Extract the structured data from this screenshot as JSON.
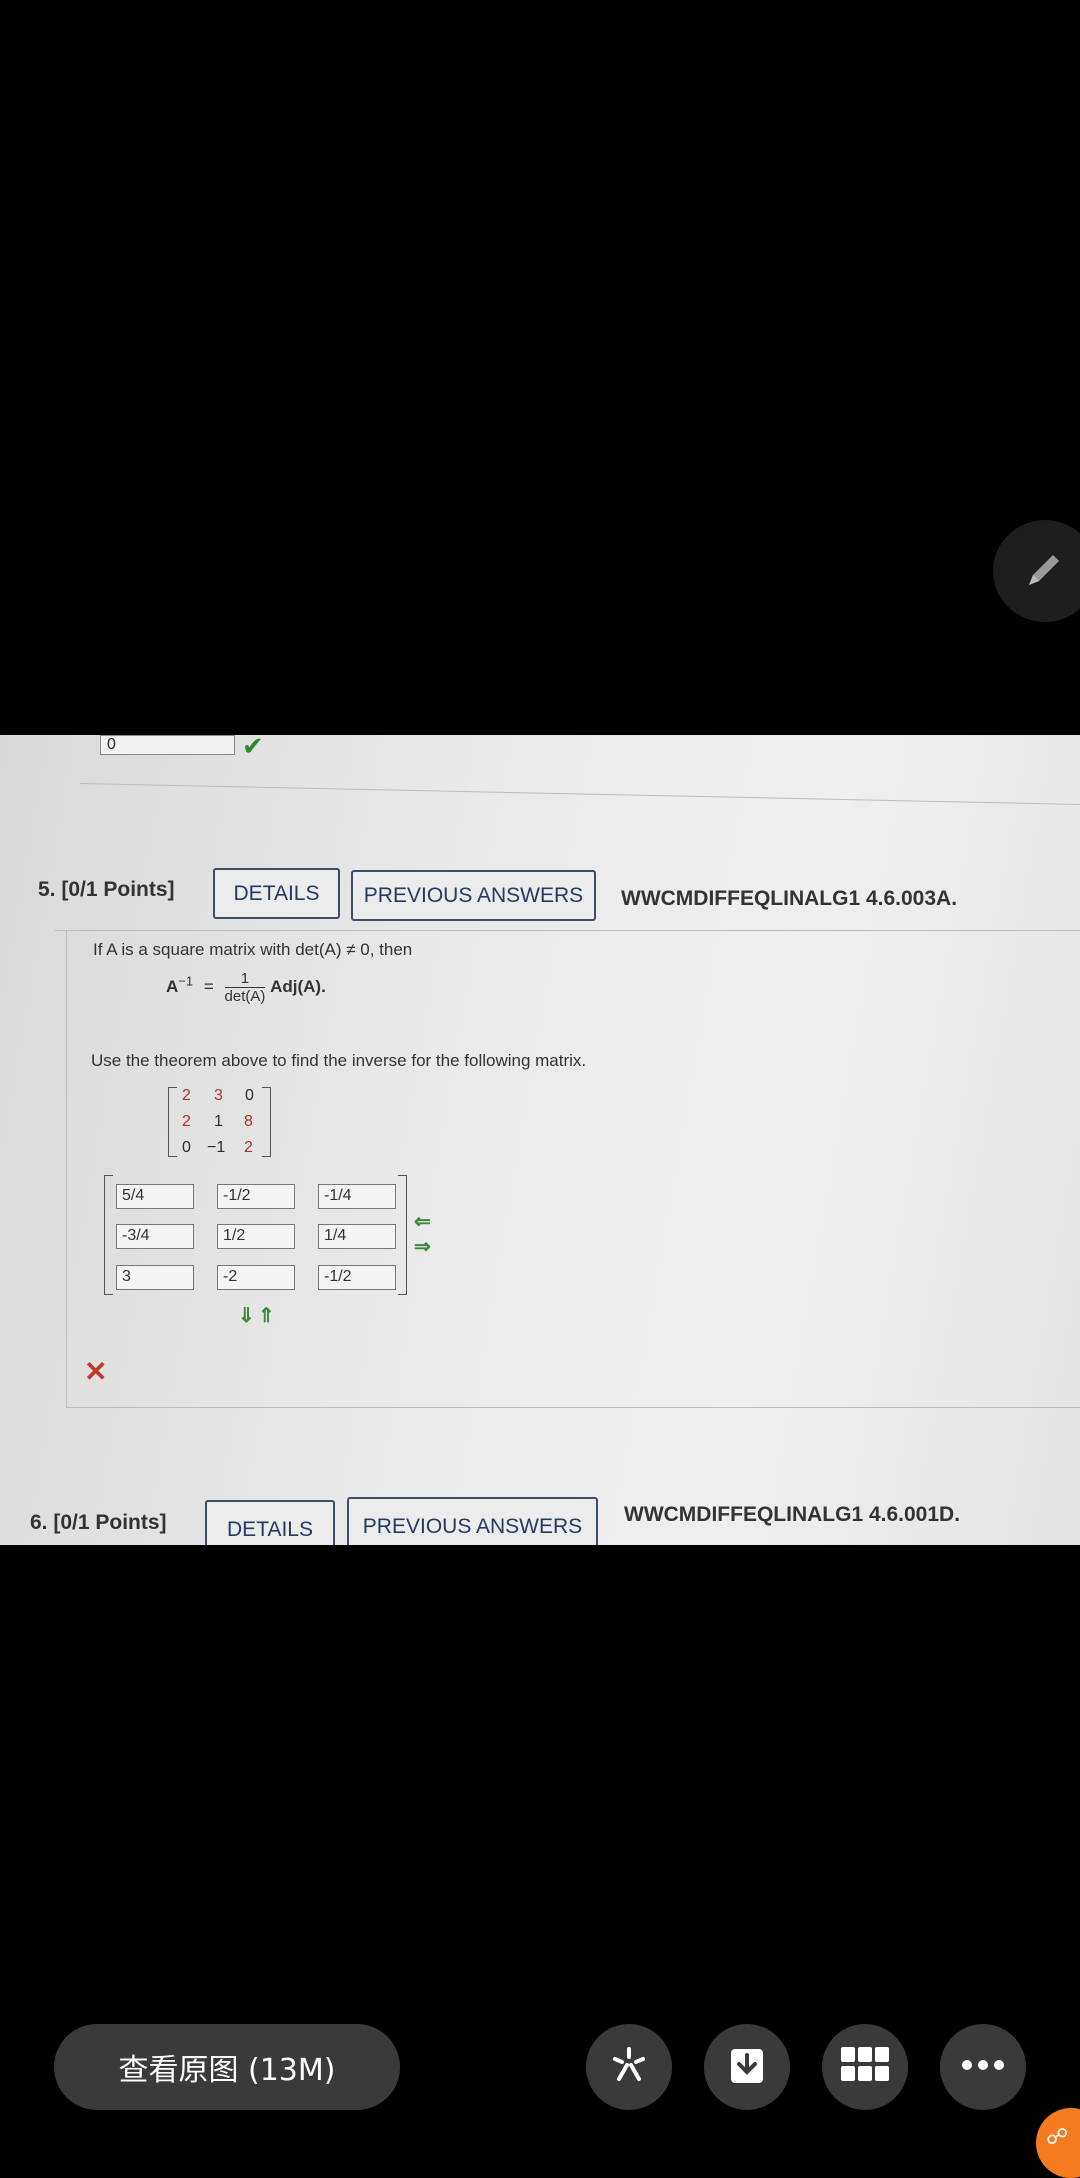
{
  "prev_question": {
    "answer_value": "0"
  },
  "question5": {
    "number": "5.",
    "points": "[0/1 Points]",
    "details_label": "DETAILS",
    "prev_answers_label": "PREVIOUS ANSWERS",
    "code": "WWCMDIFFEQLINALG1 4.6.003A.",
    "theorem_intro": "If A is a square matrix with det(A) ≠ 0, then",
    "formula_lhs": "A",
    "formula_sup": "−1",
    "formula_eq": "=",
    "formula_num": "1",
    "formula_den": "det(A)",
    "formula_rhs": "Adj(A).",
    "instruction": "Use the theorem above to find the inverse for the following matrix.",
    "matrix": [
      [
        "2",
        "3",
        "0"
      ],
      [
        "2",
        "1",
        "8"
      ],
      [
        "0",
        "−1",
        "2"
      ]
    ],
    "answers": [
      [
        "5/4",
        "-1/2",
        "-1/4"
      ],
      [
        "-3/4",
        "1/2",
        "1/4"
      ],
      [
        "3",
        "-2",
        "-1/2"
      ]
    ]
  },
  "question6": {
    "number": "6.",
    "points": "[0/1 Points]",
    "details_label": "DETAILS",
    "prev_answers_label": "PREVIOUS ANSWERS",
    "code": "WWCMDIFFEQLINALG1 4.6.001D."
  },
  "viewer": {
    "view_original_label": "查看原图 (13M)"
  },
  "colors": {
    "bg": "#000000",
    "accent_orange": "#f47b20",
    "button_bg": "#3a3a3a"
  }
}
